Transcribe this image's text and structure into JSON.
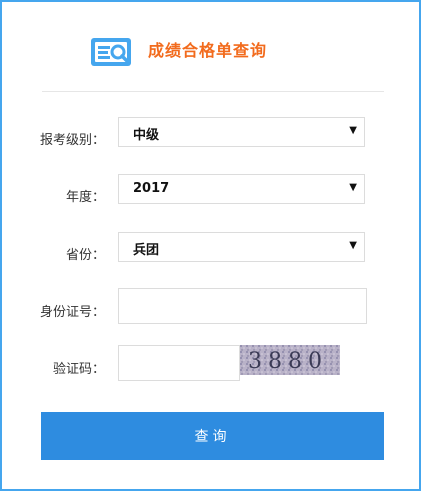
{
  "header": {
    "title": "成绩合格单查询",
    "icon": "search-document-icon",
    "title_color": "#f26b1d",
    "icon_color": "#45a6ee"
  },
  "form": {
    "level": {
      "label": "报考级别：",
      "value": "中级"
    },
    "year": {
      "label": "年度：",
      "value": "2017"
    },
    "province": {
      "label": "省份：",
      "value": "兵团"
    },
    "id_number": {
      "label": "身份证号：",
      "value": ""
    },
    "captcha": {
      "label": "验证码：",
      "value": "",
      "image_text": "3880"
    },
    "submit_label": "查询"
  },
  "colors": {
    "border": "#45a6ee",
    "button": "#2e8ce0"
  }
}
